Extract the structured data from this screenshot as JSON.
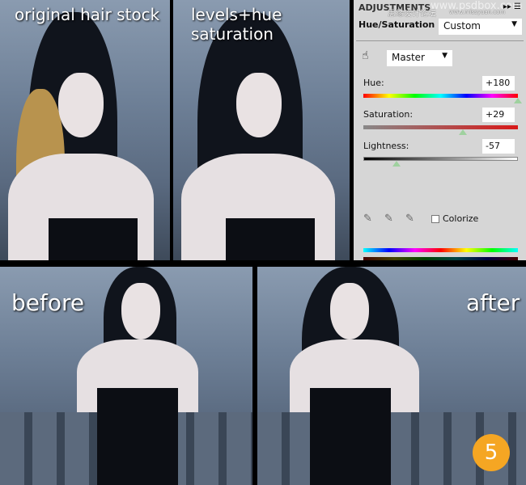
{
  "captions": {
    "original": "original hair stock",
    "levels": "levels+hue saturation",
    "before": "before",
    "after": "after"
  },
  "panel": {
    "title": "ADJUSTMENTS",
    "watermark_cn": "思缘设计论坛",
    "watermark_url": "www.missyuan.com",
    "watermark_psdbox": "www.psdbox.com",
    "name": "Hue/Saturation",
    "preset": "Custom",
    "channel": "Master",
    "hue_label": "Hue:",
    "hue_value": "+180",
    "hue_level": 180,
    "saturation_label": "Saturation:",
    "saturation_value": "+29",
    "saturation_level": 29,
    "lightness_label": "Lightness:",
    "lightness_value": "-57",
    "lightness_level": -57,
    "colorize_label": "Colorize",
    "colorize_checked": false
  },
  "step_badge": "5",
  "colors": {
    "badge": "#f5a623",
    "panel_bg": "#d6d6d6"
  }
}
